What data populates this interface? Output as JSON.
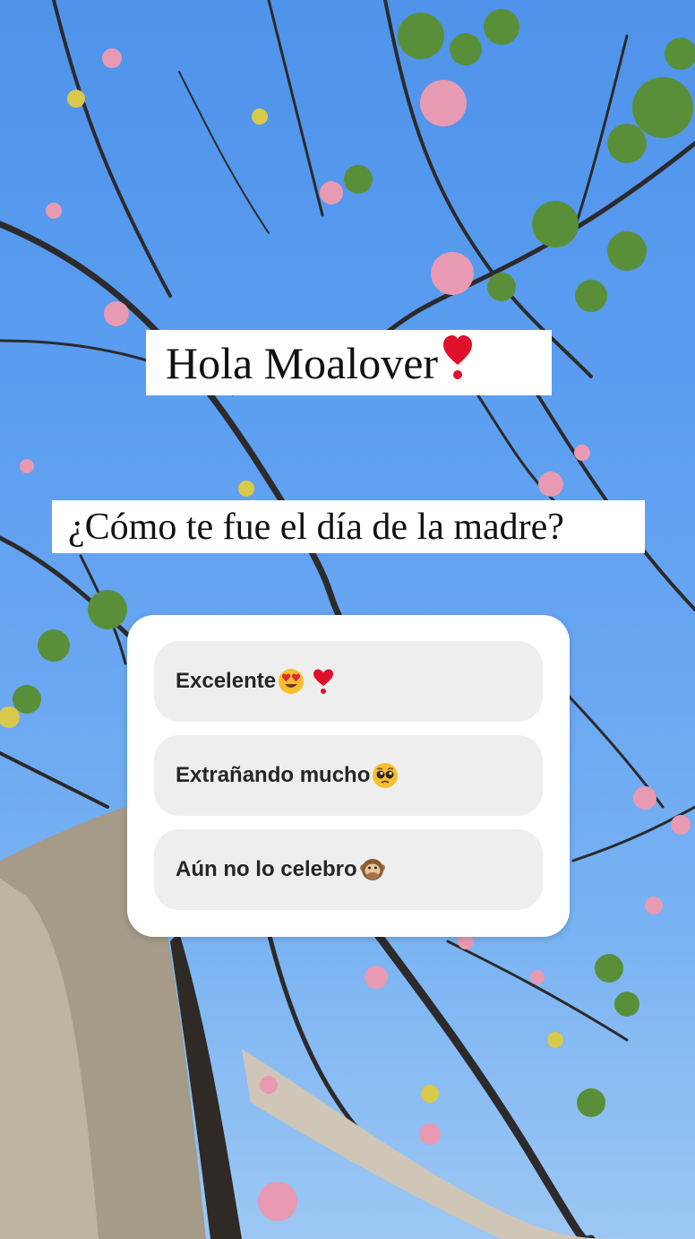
{
  "story": {
    "greeting": "Hola Moalover",
    "greeting_emoji": "heavy-heart-exclamation-icon",
    "question": "¿Cómo te fue el día de la madre?"
  },
  "quiz": {
    "options": [
      {
        "label": "Excelente",
        "emoji": [
          "heart-eyes-face-icon",
          "heavy-heart-exclamation-icon"
        ]
      },
      {
        "label": "Extrañando mucho",
        "emoji": [
          "pleading-face-icon"
        ]
      },
      {
        "label": "Aún no lo celebro",
        "emoji": [
          "speak-no-evil-monkey-icon"
        ]
      }
    ]
  },
  "colors": {
    "sky": "#5a9df0",
    "card": "#ffffff",
    "option_bg": "#eeeeee",
    "option_text": "#262626",
    "heart_red": "#e0102b"
  }
}
